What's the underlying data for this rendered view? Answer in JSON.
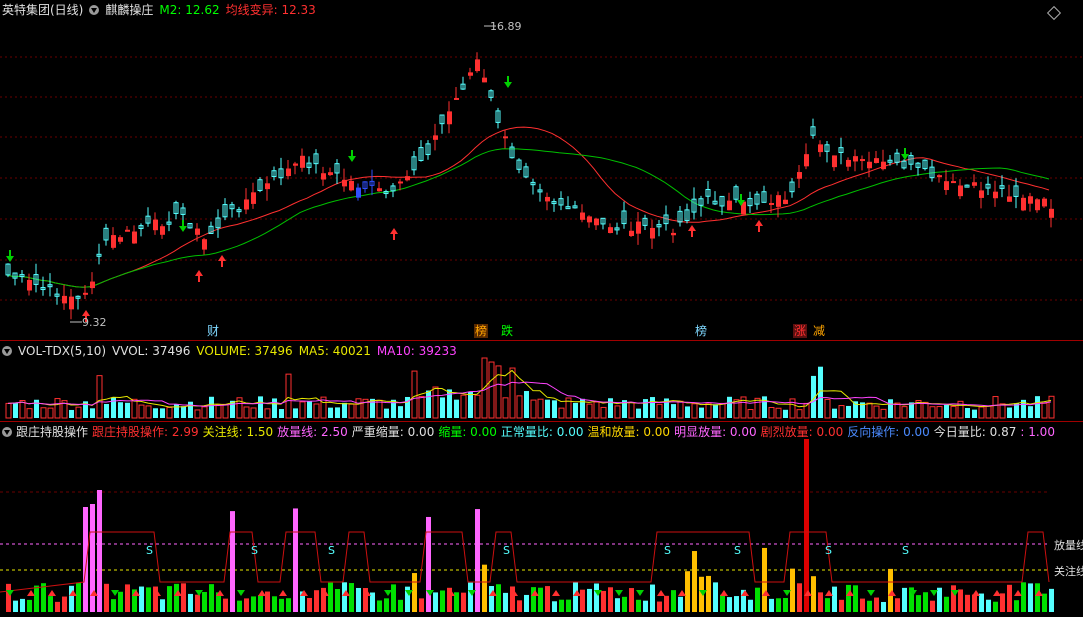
{
  "price_panel": {
    "stock_name": "英特集团(日线)",
    "indicator": "麒麟操庄",
    "m2_label": "M2: 12.62",
    "ma_label": "均线变异: 12.33",
    "high_label": "16.89",
    "low_label": "9.32",
    "events": [
      {
        "text": "财",
        "color": "#7fd8ff"
      },
      {
        "text": "榜",
        "color": "#ffa500"
      },
      {
        "text": "跌",
        "color": "#00ff00"
      },
      {
        "text": "榜",
        "color": "#7fd8ff"
      },
      {
        "text": "涨",
        "color": "#ff3030"
      },
      {
        "text": "减",
        "color": "#ffa500"
      }
    ]
  },
  "volume_panel": {
    "name": "VOL-TDX(5,10)",
    "vvol": "VVOL: 37496",
    "volume": "VOLUME: 37496",
    "ma5": "MA5: 40021",
    "ma10": "MA10: 39233"
  },
  "indicator_panel": {
    "name": "跟庄持股操作",
    "items": [
      {
        "text": "跟庄持股操作: 2.99",
        "color": "#ff3030"
      },
      {
        "text": "关注线: 1.50",
        "color": "#e8e800"
      },
      {
        "text": "放量线: 2.50",
        "color": "#ff66ff"
      },
      {
        "text": "严重缩量: 0.00",
        "color": "#e0e0e0"
      },
      {
        "text": "缩量: 0.00",
        "color": "#00ff00"
      },
      {
        "text": "正常量比: 0.00",
        "color": "#55ffff"
      },
      {
        "text": "温和放量: 0.00",
        "color": "#ffd700"
      },
      {
        "text": "明显放量: 0.00",
        "color": "#ff66ff"
      },
      {
        "text": "剧烈放量: 0.00",
        "color": "#ff3030"
      },
      {
        "text": "反向操作: 0.00",
        "color": "#4b8bff"
      },
      {
        "text": "今日量比: 0.87",
        "color": "#e0e0e0"
      },
      {
        "text": ": 1.00",
        "color": "#ff66ff"
      }
    ],
    "right_labels": {
      "surge": "放量线",
      "watch": "关注线"
    },
    "s_marker": "S"
  },
  "colors": {
    "up": "#ff3030",
    "down": "#55ffff",
    "ma_short": "#ff3030",
    "ma_long": "#00d000",
    "grid": "#7a0000"
  }
}
